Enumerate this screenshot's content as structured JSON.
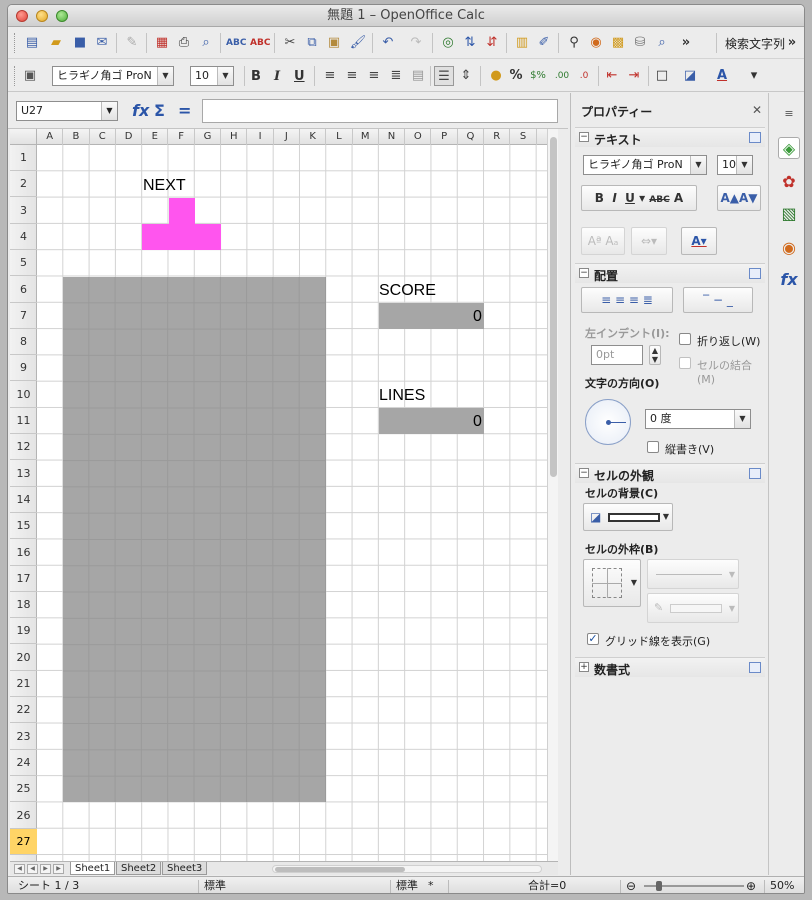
{
  "window": {
    "title": "無題 1 – OpenOffice Calc"
  },
  "toolbar": {
    "search_label": "検索文字列",
    "font_name": "ヒラギノ角ゴ ProN",
    "font_size": "10",
    "overflow": "»"
  },
  "formula": {
    "cell_ref": "U27",
    "fx_icon": "function-wizard-icon",
    "sum_icon": "sum-icon",
    "equals": "="
  },
  "sheet": {
    "columns": [
      "A",
      "B",
      "C",
      "D",
      "E",
      "F",
      "G",
      "H",
      "I",
      "J",
      "K",
      "L",
      "M",
      "N",
      "O",
      "P",
      "Q",
      "R",
      "S"
    ],
    "rows": [
      "1",
      "2",
      "3",
      "4",
      "5",
      "6",
      "7",
      "8",
      "9",
      "10",
      "11",
      "12",
      "13",
      "14",
      "15",
      "16",
      "17",
      "18",
      "19",
      "20",
      "21",
      "22",
      "23",
      "24",
      "25",
      "26",
      "27"
    ],
    "active_row": "27",
    "next_label": "NEXT",
    "score_label": "SCORE",
    "score_value": "0",
    "lines_label": "LINES",
    "lines_value": "0",
    "piece_color": "#ff55ee",
    "board_color": "#a6a6a6"
  },
  "tabs": [
    "Sheet1",
    "Sheet2",
    "Sheet3"
  ],
  "status": {
    "sheet_pos": "シート 1 / 3",
    "style": "標準",
    "mode": "標準",
    "modified": "*",
    "sum": "合計=0",
    "zoom": "50%"
  },
  "sidebar": {
    "title": "プロパティー",
    "text_section": "テキスト",
    "font_name": "ヒラギノ角ゴ ProN",
    "font_size": "10",
    "align_section": "配置",
    "left_indent": "左インデント(I):",
    "indent_value": "0pt",
    "wrap": "折り返し(W)",
    "merge": "セルの結合(M)",
    "direction": "文字の方向(O)",
    "angle": "0 度",
    "vertical": "縦書き(V)",
    "appearance_section": "セルの外観",
    "bg_label": "セルの背景(C)",
    "border_label": "セルの外枠(B)",
    "gridlines": "グリッド線を表示(G)",
    "number_section": "数書式"
  }
}
